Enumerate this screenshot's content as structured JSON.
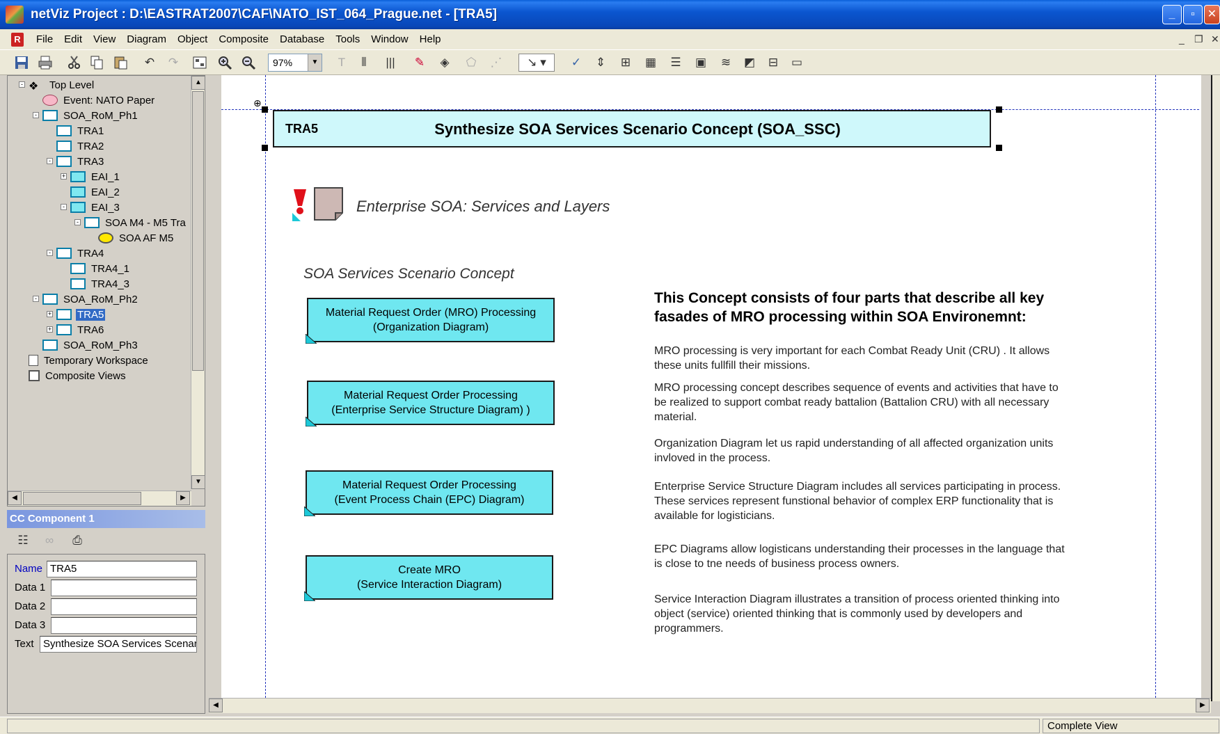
{
  "window": {
    "title": "netViz Project : D:\\EASTRAT2007\\CAF\\NATO_IST_064_Prague.net - [TRA5]",
    "minimize": "_",
    "maximize": "▫",
    "close": "✕"
  },
  "menu": {
    "items": [
      "File",
      "Edit",
      "View",
      "Diagram",
      "Object",
      "Composite",
      "Database",
      "Tools",
      "Window",
      "Help"
    ],
    "mdi_minimize": "_",
    "mdi_restore": "❐",
    "mdi_close": "✕"
  },
  "toolbar": {
    "zoom": "97%"
  },
  "tree": {
    "items": [
      {
        "label": "Top Level"
      },
      {
        "label": "Event: NATO Paper"
      },
      {
        "label": "SOA_RoM_Ph1"
      },
      {
        "label": "TRA1"
      },
      {
        "label": "TRA2"
      },
      {
        "label": "TRA3"
      },
      {
        "label": "EAI_1"
      },
      {
        "label": "EAI_2"
      },
      {
        "label": "EAI_3"
      },
      {
        "label": "SOA M4 - M5 Tra"
      },
      {
        "label": "SOA AF M5"
      },
      {
        "label": "TRA4"
      },
      {
        "label": "TRA4_1"
      },
      {
        "label": "TRA4_3"
      },
      {
        "label": "SOA_RoM_Ph2"
      },
      {
        "label": "TRA5"
      },
      {
        "label": "TRA6"
      },
      {
        "label": "SOA_RoM_Ph3"
      },
      {
        "label": "Temporary Workspace"
      },
      {
        "label": "Composite Views"
      }
    ],
    "selected": "TRA5"
  },
  "component": {
    "header": "CC Component 1",
    "fields": {
      "name_label": "Name",
      "name_value": "TRA5",
      "data1_label": "Data 1",
      "data1_value": "",
      "data2_label": "Data 2",
      "data2_value": "",
      "data3_label": "Data 3",
      "data3_value": "",
      "text_label": "Text",
      "text_value": "Synthesize SOA Services Scenari"
    }
  },
  "canvas": {
    "header_code": "TRA5",
    "header_title": "Synthesize SOA Services Scenario Concept  (SOA_SSC)",
    "enterprise_link": "Enterprise SOA: Services and  Layers",
    "section_title": "SOA Services Scenario Concept",
    "boxes": [
      {
        "line1": "Material Request Order (MRO) Processing",
        "line2": "(Organization Diagram)"
      },
      {
        "line1": "Material Request Order Processing",
        "line2": "(Enterprise Service Structure Diagram) )"
      },
      {
        "line1": "Material Request Order Processing",
        "line2": "(Event Process Chain (EPC) Diagram)"
      },
      {
        "line1": "Create MRO",
        "line2": "(Service Interaction Diagram)"
      }
    ],
    "description_title": "This Concept consists of four parts that describe all key fasades of MRO processing within SOA Environemnt:",
    "paragraphs": [
      "MRO processing is very important for each Combat Ready Unit (CRU) . It allows these units fullfill their missions.",
      "MRO processing concept describes sequence of events and activities that have to be realized to support combat ready battalion (Battalion CRU) with all necessary material.",
      "Organization Diagram let us rapid understanding of all affected organization units invloved in the process.",
      "Enterprise Service Structure Diagram includes all services participating in process. These services represent funstional behavior of complex ERP functionality that is available for logisticians.",
      "EPC Diagrams allow logisticans understanding their processes in the language that is close to tne needs of business process owners.",
      "Service Interaction Diagram illustrates a transition of process oriented thinking into object (service) oriented thinking that is commonly used by developers and programmers."
    ]
  },
  "status": {
    "view": "Complete View"
  },
  "colors": {
    "titlebar": "#0b56d0",
    "box_fill": "#6fe7f0",
    "header_fill": "#cff8fb",
    "selection": "#316ac5"
  }
}
